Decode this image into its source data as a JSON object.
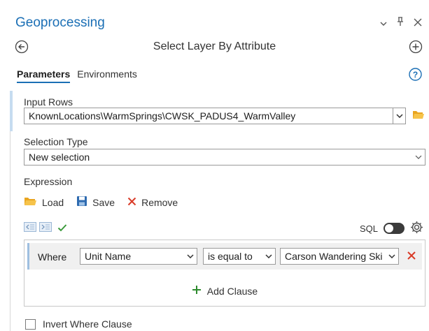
{
  "pane": {
    "title": "Geoprocessing",
    "menu_icon": "chevron-down-icon",
    "pin_icon": "pin-icon",
    "close_icon": "close-icon"
  },
  "tool": {
    "title": "Select Layer By Attribute",
    "back_icon": "back-arrow-icon",
    "add_icon": "add-icon"
  },
  "tabs": [
    {
      "label": "Parameters",
      "active": true
    },
    {
      "label": "Environments",
      "active": false
    }
  ],
  "help_icon": "help-icon",
  "input_rows": {
    "label": "Input Rows",
    "value": "KnownLocations\\WarmSprings\\CWSK_PADUS4_WarmValley"
  },
  "selection_type": {
    "label": "Selection Type",
    "value": "New selection"
  },
  "expression": {
    "label": "Expression",
    "load_label": "Load",
    "save_label": "Save",
    "remove_label": "Remove",
    "sql_label": "SQL",
    "sql_enabled": false
  },
  "clause": {
    "where_label": "Where",
    "field": "Unit Name",
    "operator": "is equal to",
    "value": "Carson Wandering Ski",
    "add_clause_label": "Add Clause"
  },
  "invert_where": {
    "label": "Invert Where Clause",
    "checked": false
  },
  "colors": {
    "accent": "#1b6fb5",
    "folder": "#f2b531",
    "save": "#2e6bb0",
    "remove": "#d93b28",
    "add": "#2e8b2e",
    "check": "#3a9a3a"
  }
}
